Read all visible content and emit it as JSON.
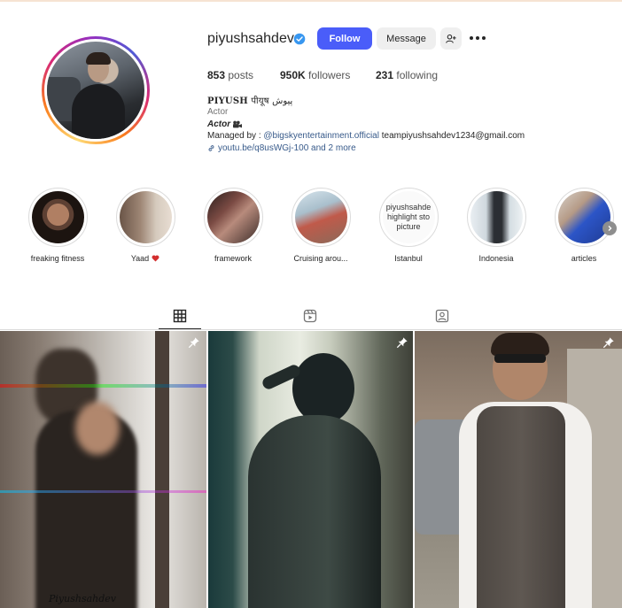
{
  "profile": {
    "username": "piyushsahdev",
    "follow_label": "Follow",
    "message_label": "Message",
    "stats": {
      "posts_count": "853",
      "posts_label": "posts",
      "followers_count": "950K",
      "followers_label": "followers",
      "following_count": "231",
      "following_label": "following"
    },
    "bio": {
      "name_latin": "PIYUSH",
      "name_other": " पीयूष پیوش",
      "category": "Actor",
      "line": "Actor",
      "managed_prefix": "Managed by : ",
      "managed_mention": "@bigskyentertainment.official",
      "managed_email": " teampiyushsahdev1234@gmail.com",
      "link": "youtu.be/q8usWGj-100 and 2 more"
    }
  },
  "highlights": [
    {
      "label": "freaking fitness"
    },
    {
      "label": "Yaad"
    },
    {
      "label": "framework"
    },
    {
      "label": "Cruising arou..."
    },
    {
      "label": "Istanbul",
      "cover_text": "piyushsahde highlight sto picture"
    },
    {
      "label": "Indonesia"
    },
    {
      "label": "articles"
    }
  ],
  "tabs": [
    {
      "name": "posts",
      "icon": "grid-icon",
      "active": true
    },
    {
      "name": "reels",
      "icon": "reels-icon",
      "active": false
    },
    {
      "name": "tagged",
      "icon": "tagged-icon",
      "active": false
    }
  ],
  "posts": {
    "caption_overlay": "Piyushsahdev"
  },
  "colors": {
    "follow_button": "#4a5df9",
    "link": "#375a8a",
    "verified": "#3897f0"
  }
}
